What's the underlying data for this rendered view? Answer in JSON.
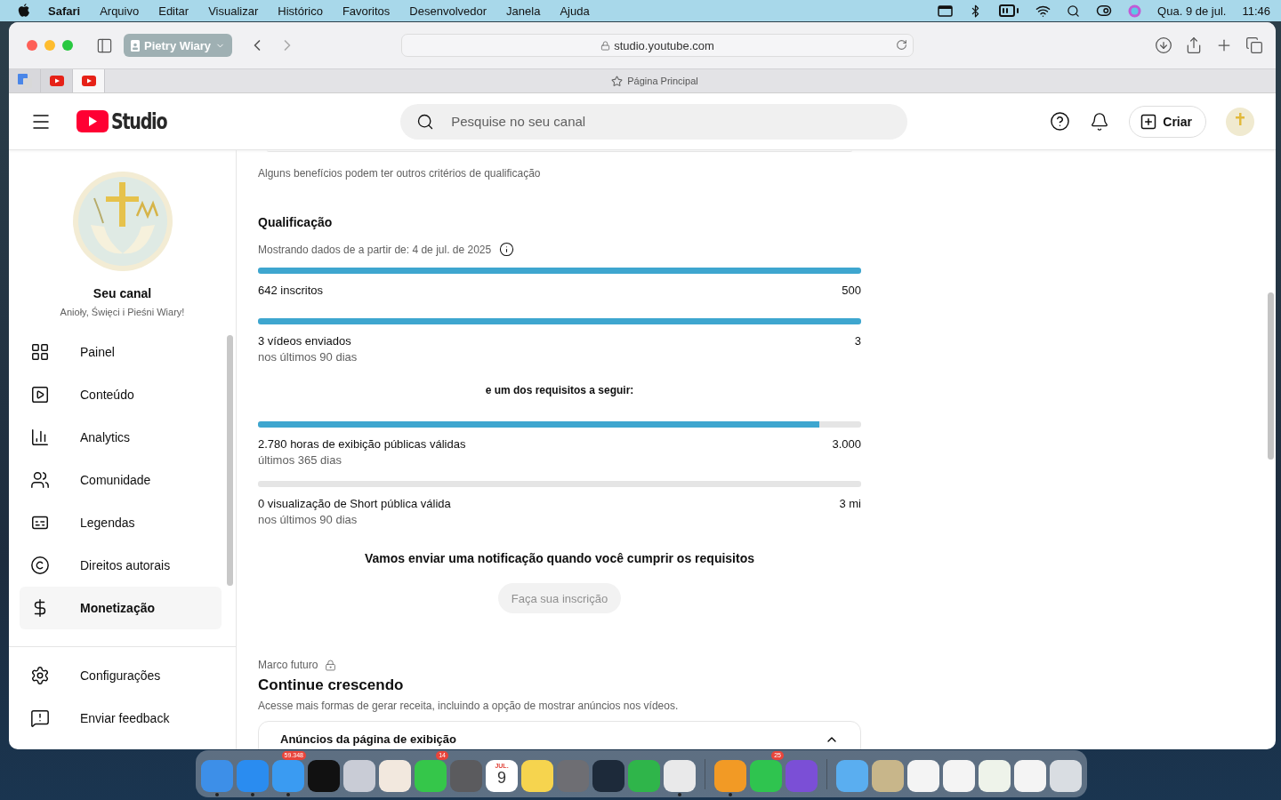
{
  "menu_bar": {
    "app": "Safari",
    "menus": [
      "Arquivo",
      "Editar",
      "Visualizar",
      "Histórico",
      "Favoritos",
      "Desenvolvedor",
      "Janela",
      "Ajuda"
    ],
    "date": "Qua. 9 de jul.",
    "time": "11:46"
  },
  "browser": {
    "profile": "Pietry Wiary",
    "url": "studio.youtube.com",
    "tabs": [
      {
        "kind": "translate",
        "selected": false
      },
      {
        "kind": "youtube",
        "selected": false
      },
      {
        "kind": "youtube",
        "selected": true
      }
    ],
    "page_title": "Página Principal"
  },
  "header": {
    "logo": "Studio",
    "search_placeholder": "Pesquise no seu canal",
    "create": "Criar"
  },
  "sidebar": {
    "channel_label": "Seu canal",
    "channel_name": "Anioły, Święci i Pieśni Wiary!",
    "items": [
      {
        "label": "Painel",
        "kind": "dashboard",
        "selected": false
      },
      {
        "label": "Conteúdo",
        "kind": "content",
        "selected": false
      },
      {
        "label": "Analytics",
        "kind": "analytics",
        "selected": false
      },
      {
        "label": "Comunidade",
        "kind": "community",
        "selected": false
      },
      {
        "label": "Legendas",
        "kind": "subtitles",
        "selected": false
      },
      {
        "label": "Direitos autorais",
        "kind": "copyright",
        "selected": false
      },
      {
        "label": "Monetização",
        "kind": "money",
        "selected": true
      }
    ],
    "footer_items": [
      {
        "label": "Configurações",
        "kind": "settings"
      },
      {
        "label": "Enviar feedback",
        "kind": "feedback"
      }
    ]
  },
  "content": {
    "note": "Alguns benefícios podem ter outros critérios de qualificação",
    "section_title": "Qualificação",
    "data_since": "Mostrando dados de a partir de: 4 de jul. de 2025",
    "required": [
      {
        "label": "642 inscritos",
        "target": "500",
        "level": 1
      },
      {
        "label": "3 vídeos enviados",
        "sublabel": "nos últimos 90 dias",
        "target": "3",
        "level": 1
      }
    ],
    "either_label": "e um dos requisitos a seguir:",
    "either": [
      {
        "label": "2.780 horas de exibição públicas válidas",
        "sublabel": "últimos 365 dias",
        "target": "3.000",
        "level": 0.93
      },
      {
        "label": "0 visualização de Short pública válida",
        "sublabel": "nos últimos 90 dias",
        "target": "3 mi",
        "level": 0
      }
    ],
    "notice": "Vamos enviar uma notificação quando você cumprir os requisitos",
    "button": {
      "label": "Faça sua inscrição",
      "disabled": true
    },
    "milestone": {
      "label": "Marco futuro",
      "title": "Continue crescendo",
      "description": "Acesse mais formas de gerar receita, incluindo a opção de mostrar anúncios nos vídeos.",
      "card_title": "Anúncios da página de exibição"
    }
  },
  "dock": [
    {
      "kind": "app",
      "color": "#3d8fe8",
      "running": true
    },
    {
      "kind": "app",
      "color": "#2a8cf0",
      "running": true
    },
    {
      "kind": "app",
      "color": "#3a9bf2",
      "running": true,
      "badge": "59.348"
    },
    {
      "kind": "app",
      "color": "#111111",
      "running": false
    },
    {
      "kind": "app",
      "color": "#c9ccd6",
      "running": false
    },
    {
      "kind": "app",
      "color": "#f2e8de",
      "running": false
    },
    {
      "kind": "app",
      "color": "#35c64a",
      "running": false,
      "badge": "14"
    },
    {
      "kind": "app",
      "color": "#5b5b5e",
      "running": false
    },
    {
      "kind": "calendar",
      "month": "JUL.",
      "day": "9",
      "running": false
    },
    {
      "kind": "app",
      "color": "#f6d44e",
      "running": false
    },
    {
      "kind": "app",
      "color": "#6e6e73",
      "running": false
    },
    {
      "kind": "app",
      "color": "#1d2a3a",
      "running": false
    },
    {
      "kind": "app",
      "color": "#2fb54a",
      "running": false
    },
    {
      "kind": "app",
      "color": "#e9e9ea",
      "running": true
    },
    {
      "kind": "separator"
    },
    {
      "kind": "app",
      "color": "#f29a25",
      "running": true
    },
    {
      "kind": "app",
      "color": "#2fc44f",
      "running": false,
      "badge": "25"
    },
    {
      "kind": "app",
      "color": "#7b4fd6",
      "running": false
    },
    {
      "kind": "separator"
    },
    {
      "kind": "app",
      "color": "#5aaef0",
      "running": false
    },
    {
      "kind": "app",
      "color": "#c8b68a",
      "running": false
    },
    {
      "kind": "app",
      "color": "#f4f4f4",
      "running": false
    },
    {
      "kind": "app",
      "color": "#f4f4f4",
      "running": false
    },
    {
      "kind": "app",
      "color": "#eef3ea",
      "running": false
    },
    {
      "kind": "app",
      "color": "#f4f4f4",
      "running": false
    },
    {
      "kind": "app",
      "color": "#d9dde2",
      "running": false
    }
  ]
}
